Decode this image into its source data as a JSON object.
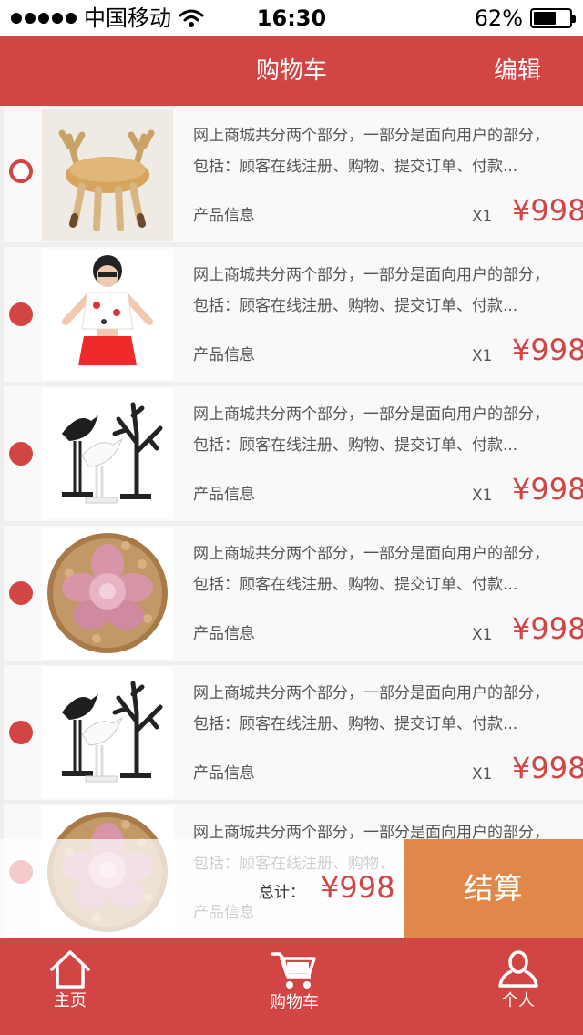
{
  "status_bar": {
    "carrier": "中国移动",
    "time": "16:30",
    "battery": "62%",
    "battery_level": 0.62
  },
  "header": {
    "title": "购物车",
    "edit": "编辑"
  },
  "items": [
    {
      "description_line1": "网上商城共分两个部分，一部分是面向用户的部分，",
      "description_line2": "包括：顾客在线注册、购物、提交订单、付款...",
      "info_label": "产品信息",
      "quantity": "X1",
      "price": "¥998",
      "selected": false,
      "image": "deer-stool-image"
    },
    {
      "description_line1": "网上商城共分两个部分，一部分是面向用户的部分，",
      "description_line2": "包括：顾客在线注册、购物、提交订单、付款...",
      "info_label": "产品信息",
      "quantity": "X1",
      "price": "¥998",
      "selected": true,
      "image": "fashion-outfit-image"
    },
    {
      "description_line1": "网上商城共分两个部分，一部分是面向用户的部分，",
      "description_line2": "包括：顾客在线注册、购物、提交订单、付款...",
      "info_label": "产品信息",
      "quantity": "X1",
      "price": "¥998",
      "selected": true,
      "image": "bird-tree-decor-image"
    },
    {
      "description_line1": "网上商城共分两个部分，一部分是面向用户的部分，",
      "description_line2": "包括：顾客在线注册、购物、提交订单、付款...",
      "info_label": "产品信息",
      "quantity": "X1",
      "price": "¥998",
      "selected": true,
      "image": "succulent-plant-image"
    },
    {
      "description_line1": "网上商城共分两个部分，一部分是面向用户的部分，",
      "description_line2": "包括：顾客在线注册、购物、提交订单、付款...",
      "info_label": "产品信息",
      "quantity": "X1",
      "price": "¥998",
      "selected": true,
      "image": "bird-tree-decor-image"
    },
    {
      "description_line1": "网上商城共分两个部分，一部分是面向用户的部分，",
      "description_line2": "包括：顾客在线注册、购物、",
      "info_label": "产品信息",
      "quantity": "",
      "price": "",
      "selected": true,
      "image": "succulent-plant-image"
    }
  ],
  "summary": {
    "total_label": "总计：",
    "total_price": "¥998",
    "checkout": "结算"
  },
  "tabs": [
    {
      "label": "主页",
      "icon": "home-icon"
    },
    {
      "label": "购物车",
      "icon": "cart-icon"
    },
    {
      "label": "个人",
      "icon": "user-icon"
    }
  ],
  "colors": {
    "primary": "#d24545",
    "checkout": "#e0884a",
    "text": "#555555",
    "item_bg": "#f9f9f9"
  }
}
